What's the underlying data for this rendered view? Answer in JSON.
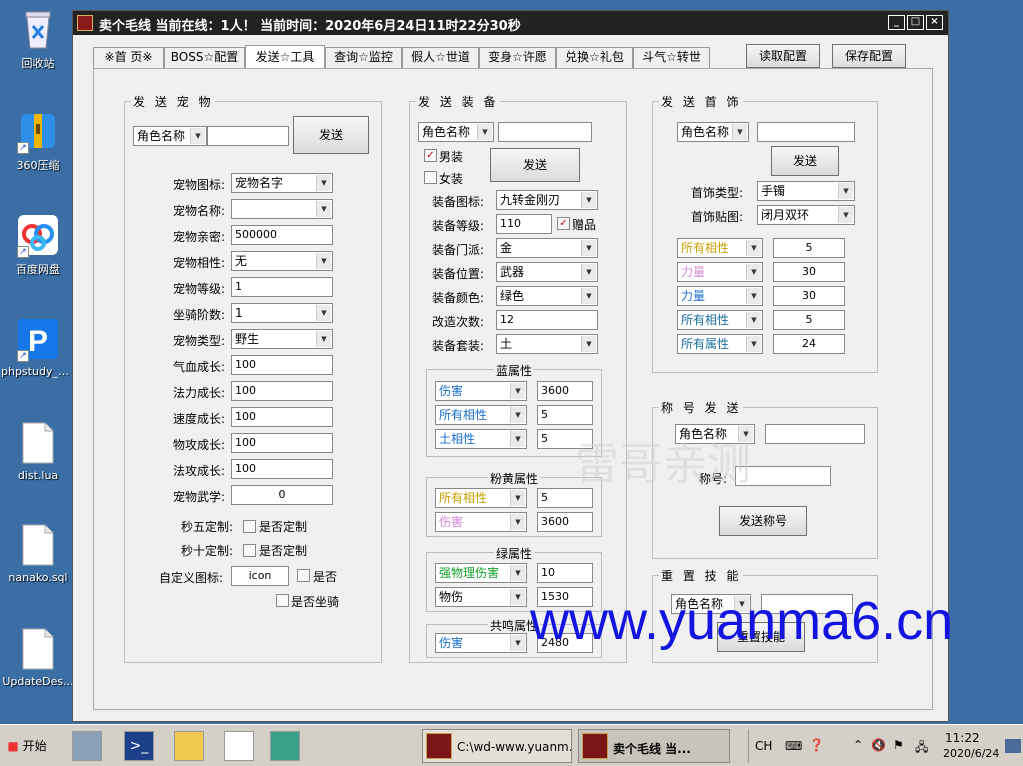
{
  "desktop": {
    "icons": [
      {
        "label": "回收站",
        "icon": "recycle-bin-icon"
      },
      {
        "label": "360压缩",
        "icon": "archive-icon"
      },
      {
        "label": "百度网盘",
        "icon": "cloud-drive-icon"
      },
      {
        "label": "phpstudy_pro",
        "icon": "phpstudy-icon"
      },
      {
        "label": "dist.lua",
        "icon": "file-icon"
      },
      {
        "label": "nanako.sql",
        "icon": "file-icon"
      },
      {
        "label": "UpdateDes...",
        "icon": "file-icon"
      }
    ]
  },
  "window": {
    "title": "卖个毛线    当前在线：1人！  当前时间：2020年6月24日11时22分30秒",
    "minimize": "_",
    "maximize": "□",
    "close": "×"
  },
  "tabs": [
    "※首 页※",
    "BOSS☆配置",
    "发送☆工具",
    "查询☆监控",
    "假人☆世道",
    "变身☆许愿",
    "兑换☆礼包",
    "斗气☆转世"
  ],
  "toolbar": {
    "load": "读取配置",
    "save": "保存配置"
  },
  "pet": {
    "title": "发 送 宠 物",
    "role_select": "角色名称",
    "role_value": "",
    "send": "发送",
    "labels": [
      "宠物图标:",
      "宠物名称:",
      "宠物亲密:",
      "宠物相性:",
      "宠物等级:",
      "坐骑阶数:",
      "宠物类型:",
      "气血成长:",
      "法力成长:",
      "速度成长:",
      "物攻成长:",
      "法攻成长:",
      "宠物武学:"
    ],
    "values": [
      "宠物名字",
      "",
      "500000",
      "无",
      "1",
      "1",
      "野生",
      "100",
      "100",
      "100",
      "100",
      "100",
      "0"
    ],
    "second5_label": "秒五定制:",
    "second10_label": "秒十定制:",
    "custom_check": "是否定制",
    "icon_label": "自定义图标:",
    "icon_value": "icon",
    "is_label": "是否",
    "mount_label": "是否坐骑"
  },
  "equip": {
    "title": "发 送 装 备",
    "role_select": "角色名称",
    "role_value": "",
    "male": "男装",
    "female": "女装",
    "send": "发送",
    "gift": "赠品",
    "labels": [
      "装备图标:",
      "装备等级:",
      "装备门派:",
      "装备位置:",
      "装备颜色:",
      "改造次数:",
      "装备套装:"
    ],
    "values": [
      "九转金刚刃",
      "110",
      "金",
      "武器",
      "绿色",
      "12",
      "土"
    ],
    "blue": {
      "title": "蓝属性",
      "rows": [
        [
          "伤害",
          "3600"
        ],
        [
          "所有相性",
          "5"
        ],
        [
          "土相性",
          "5"
        ]
      ]
    },
    "pink": {
      "title": "粉黄属性",
      "rows": [
        [
          "所有相性",
          "5"
        ],
        [
          "伤害",
          "3600"
        ]
      ]
    },
    "green": {
      "title": "绿属性",
      "rows": [
        [
          "强物理伤害",
          "10"
        ],
        [
          "物伤",
          "1530"
        ]
      ]
    },
    "resonance": {
      "title": "共鸣属性",
      "rows": [
        [
          "伤害",
          "2480"
        ]
      ]
    }
  },
  "jewel": {
    "title": "发 送 首 饰",
    "role_select": "角色名称",
    "role_value": "",
    "send": "发送",
    "type_label": "首饰类型:",
    "type_value": "手镯",
    "img_label": "首饰贴图:",
    "img_value": "闭月双环",
    "rows": [
      [
        "所有相性",
        "5"
      ],
      [
        "力量",
        "30"
      ],
      [
        "力量",
        "30"
      ],
      [
        "所有相性",
        "5"
      ],
      [
        "所有属性",
        "24"
      ]
    ]
  },
  "titlesend": {
    "title": "称 号 发 送",
    "role_select": "角色名称",
    "role_value": "",
    "name_label": "称号:",
    "name_value": "",
    "send": "发送称号"
  },
  "skill": {
    "title": "重 置 技 能",
    "role_select": "角色名称",
    "role_value": "",
    "reset": "重置技能"
  },
  "watermarks": [
    "雷哥亲测",
    "www.yuanma6.cn"
  ],
  "taskbar": {
    "start": "开始",
    "tasks": [
      "C:\\wd-www.yuanm...",
      "卖个毛线    当..."
    ],
    "ime": "CH",
    "time": "11:22",
    "date": "2020/6/24"
  },
  "colors": {
    "desktop": "#3a6ea5",
    "blue_attr": "#1a6fd0",
    "pink_attr": "#d889d8",
    "yellow_attr": "#c8a000",
    "green_attr": "#12a12a",
    "teal_attr": "#1d6fa0"
  }
}
